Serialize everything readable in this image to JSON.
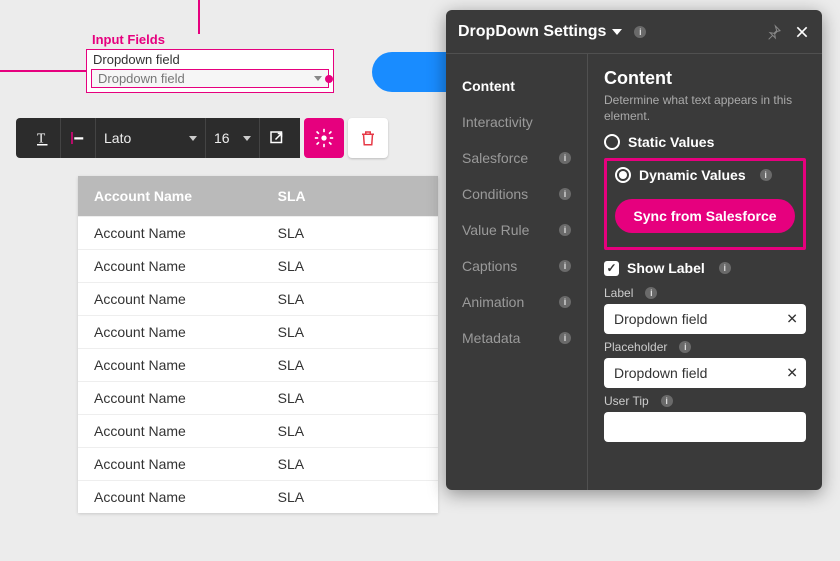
{
  "canvas": {
    "section_label": "Input Fields",
    "field_label": "Dropdown field",
    "field_placeholder": "Dropdown field"
  },
  "toolbar": {
    "font": "Lato",
    "size": "16"
  },
  "table": {
    "headers": {
      "col1": "Account Name",
      "col2": "SLA"
    },
    "rows": [
      {
        "c1": "Account Name",
        "c2": "SLA"
      },
      {
        "c1": "Account Name",
        "c2": "SLA"
      },
      {
        "c1": "Account Name",
        "c2": "SLA"
      },
      {
        "c1": "Account Name",
        "c2": "SLA"
      },
      {
        "c1": "Account Name",
        "c2": "SLA"
      },
      {
        "c1": "Account Name",
        "c2": "SLA"
      },
      {
        "c1": "Account Name",
        "c2": "SLA"
      },
      {
        "c1": "Account Name",
        "c2": "SLA"
      },
      {
        "c1": "Account Name",
        "c2": "SLA"
      }
    ]
  },
  "panel": {
    "title": "DropDown Settings",
    "tabs": [
      {
        "label": "Content",
        "info": false,
        "active": true
      },
      {
        "label": "Interactivity",
        "info": false,
        "active": false
      },
      {
        "label": "Salesforce",
        "info": true,
        "active": false
      },
      {
        "label": "Conditions",
        "info": true,
        "active": false
      },
      {
        "label": "Value Rule",
        "info": true,
        "active": false
      },
      {
        "label": "Captions",
        "info": true,
        "active": false
      },
      {
        "label": "Animation",
        "info": true,
        "active": false
      },
      {
        "label": "Metadata",
        "info": true,
        "active": false
      }
    ],
    "content": {
      "heading": "Content",
      "desc": "Determine what text appears in this element.",
      "static_label": "Static Values",
      "dynamic_label": "Dynamic Values",
      "sync_label": "Sync from Salesforce",
      "show_label": "Show Label",
      "label_title": "Label",
      "label_value": "Dropdown field",
      "placeholder_title": "Placeholder",
      "placeholder_value": "Dropdown field",
      "usertip_title": "User Tip",
      "usertip_value": ""
    }
  }
}
